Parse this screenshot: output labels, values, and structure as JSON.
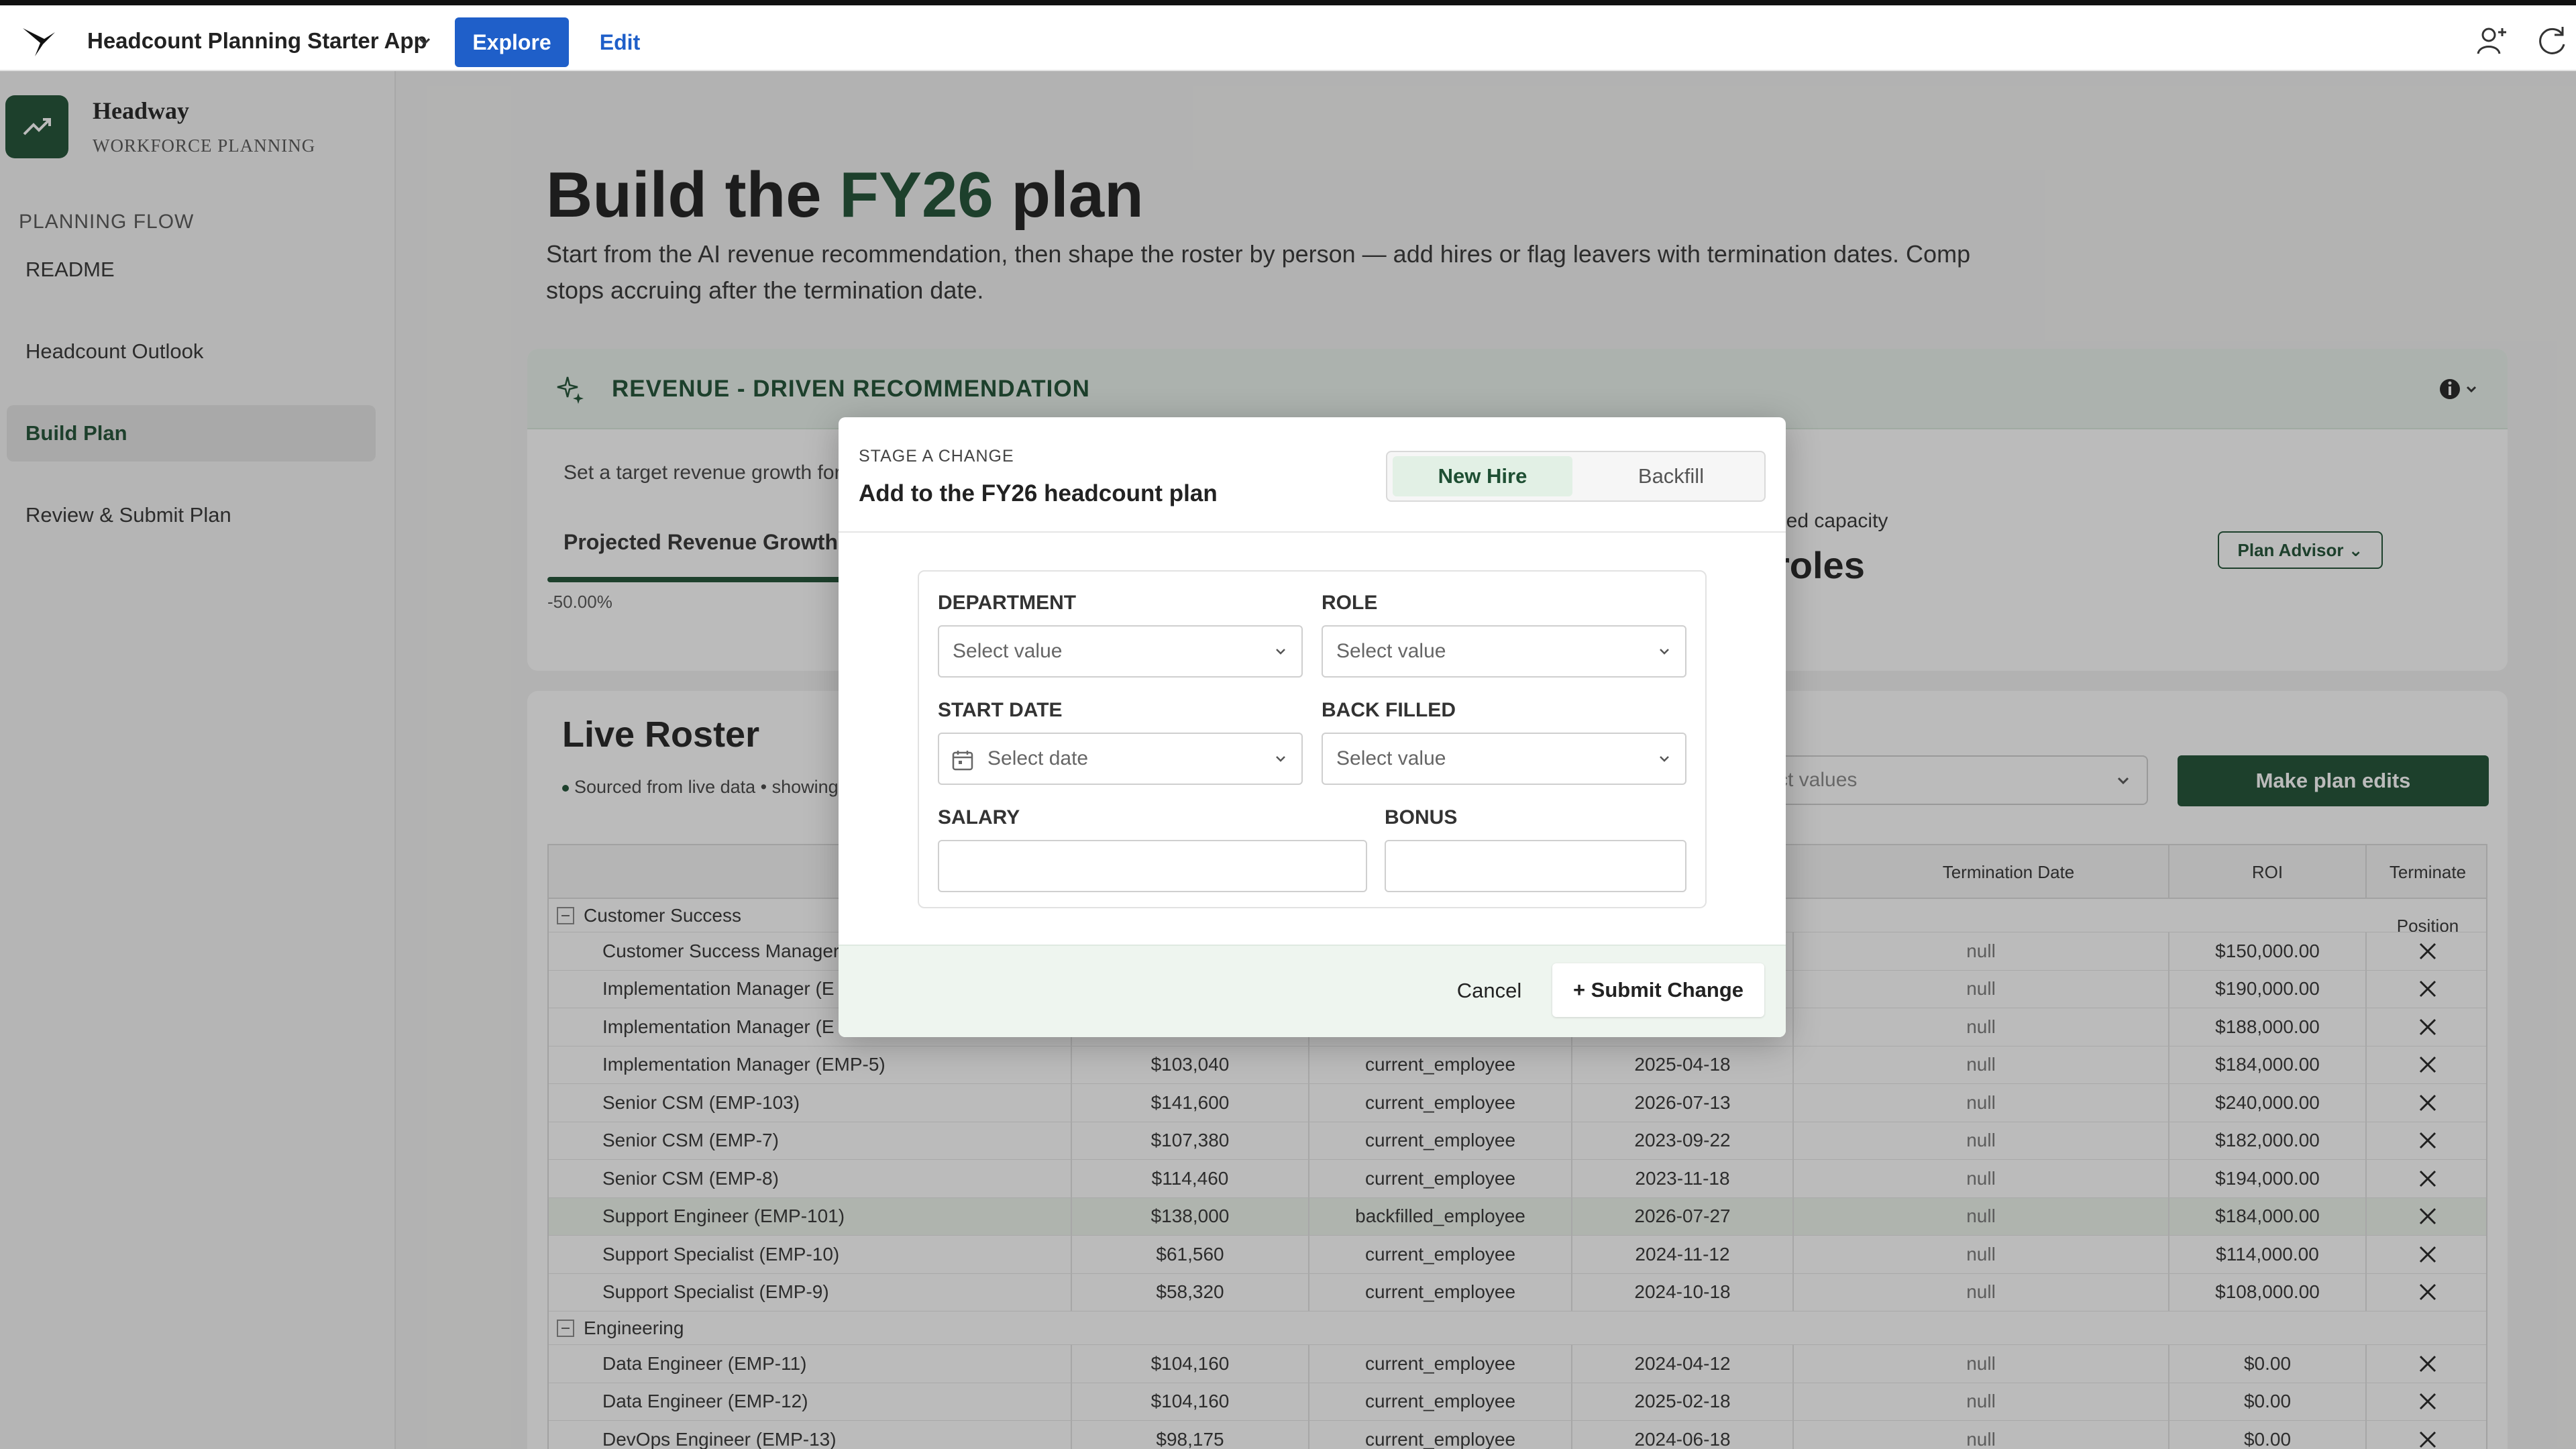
{
  "topbar": {
    "app_title": "Headcount Planning Starter App",
    "explore_label": "Explore",
    "edit_label": "Edit"
  },
  "sidebar": {
    "brand_name": "Headway",
    "brand_sub": "WORKFORCE PLANNING",
    "section_label": "PLANNING FLOW",
    "items": [
      {
        "label": "README"
      },
      {
        "label": "Headcount Outlook"
      },
      {
        "label": "Build Plan",
        "active": true
      },
      {
        "label": "Review & Submit Plan"
      }
    ]
  },
  "page": {
    "title_prefix": "Build the ",
    "title_accent": "FY26",
    "title_suffix": " plan",
    "description": "Start from the AI revenue recommendation, then shape the roster by person — add hires or flag leavers with termination dates. Comp stops accruing after the termination date."
  },
  "revenue": {
    "title": "REVENUE - DRIVEN RECOMMENDATION",
    "subtitle": "Set a target revenue growth for F",
    "tab_label": "Projected Revenue Growth",
    "min_value": "-50.00%",
    "capacity_label": "led capacity",
    "capacity_value": "roles",
    "advisor_label": "Plan Advisor"
  },
  "roster": {
    "title": "Live Roster",
    "subtitle": "Sourced from live data • showing",
    "select_placeholder": "ct values",
    "make_edits_label": "Make plan edits",
    "columns": {
      "termination_date": "Termination Date",
      "roi": "ROI",
      "terminate": "Terminate Position"
    },
    "groups": [
      {
        "name": "Customer Success",
        "rows": [
          {
            "name": "Customer Success Manager",
            "salary": "",
            "type": "",
            "start": "",
            "term": "null",
            "roi": "$150,000.00"
          },
          {
            "name": "Implementation Manager (E",
            "salary": "",
            "type": "",
            "start": "",
            "term": "null",
            "roi": "$190,000.00"
          },
          {
            "name": "Implementation Manager (E",
            "salary": "",
            "type": "",
            "start": "",
            "term": "null",
            "roi": "$188,000.00"
          },
          {
            "name": "Implementation Manager (EMP-5)",
            "salary": "$103,040",
            "type": "current_employee",
            "start": "2025-04-18",
            "term": "null",
            "roi": "$184,000.00"
          },
          {
            "name": "Senior CSM (EMP-103)",
            "salary": "$141,600",
            "type": "current_employee",
            "start": "2026-07-13",
            "term": "null",
            "roi": "$240,000.00"
          },
          {
            "name": "Senior CSM (EMP-7)",
            "salary": "$107,380",
            "type": "current_employee",
            "start": "2023-09-22",
            "term": "null",
            "roi": "$182,000.00"
          },
          {
            "name": "Senior CSM (EMP-8)",
            "salary": "$114,460",
            "type": "current_employee",
            "start": "2023-11-18",
            "term": "null",
            "roi": "$194,000.00"
          },
          {
            "name": "Support Engineer (EMP-101)",
            "salary": "$138,000",
            "type": "backfilled_employee",
            "start": "2026-07-27",
            "term": "null",
            "roi": "$184,000.00",
            "highlight": true
          },
          {
            "name": "Support Specialist (EMP-10)",
            "salary": "$61,560",
            "type": "current_employee",
            "start": "2024-11-12",
            "term": "null",
            "roi": "$114,000.00"
          },
          {
            "name": "Support Specialist (EMP-9)",
            "salary": "$58,320",
            "type": "current_employee",
            "start": "2024-10-18",
            "term": "null",
            "roi": "$108,000.00"
          }
        ]
      },
      {
        "name": "Engineering",
        "rows": [
          {
            "name": "Data Engineer (EMP-11)",
            "salary": "$104,160",
            "type": "current_employee",
            "start": "2024-04-12",
            "term": "null",
            "roi": "$0.00"
          },
          {
            "name": "Data Engineer (EMP-12)",
            "salary": "$104,160",
            "type": "current_employee",
            "start": "2025-02-18",
            "term": "null",
            "roi": "$0.00"
          },
          {
            "name": "DevOps Engineer (EMP-13)",
            "salary": "$98,175",
            "type": "current_employee",
            "start": "2024-06-18",
            "term": "null",
            "roi": "$0.00"
          }
        ]
      }
    ]
  },
  "modal": {
    "eyebrow": "STAGE A CHANGE",
    "title": "Add to the FY26 headcount plan",
    "segment_active": "New Hire",
    "segment_inactive": "Backfill",
    "department_label": "DEPARTMENT",
    "department_value": "Select value",
    "role_label": "ROLE",
    "role_value": "Select value",
    "start_date_label": "START DATE",
    "start_date_value": "Select date",
    "back_filled_label": "BACK FILLED",
    "back_filled_value": "Select value",
    "salary_label": "SALARY",
    "salary_value": "",
    "bonus_label": "BONUS",
    "bonus_value": "",
    "cancel_label": "Cancel",
    "submit_label": "+ Submit Change"
  },
  "colors": {
    "brand_green": "#1e4f33",
    "accent_blue": "#1f5fc9",
    "highlight_row": "#eef5ec"
  },
  "icons": {
    "app_logo": "bird-logo-icon",
    "user": "add-user-icon",
    "refresh": "refresh-icon",
    "brand": "trend-up-icon",
    "spark": "sparkle-icon",
    "info": "info-icon",
    "terminate": "close-icon",
    "calendar": "calendar-icon"
  }
}
